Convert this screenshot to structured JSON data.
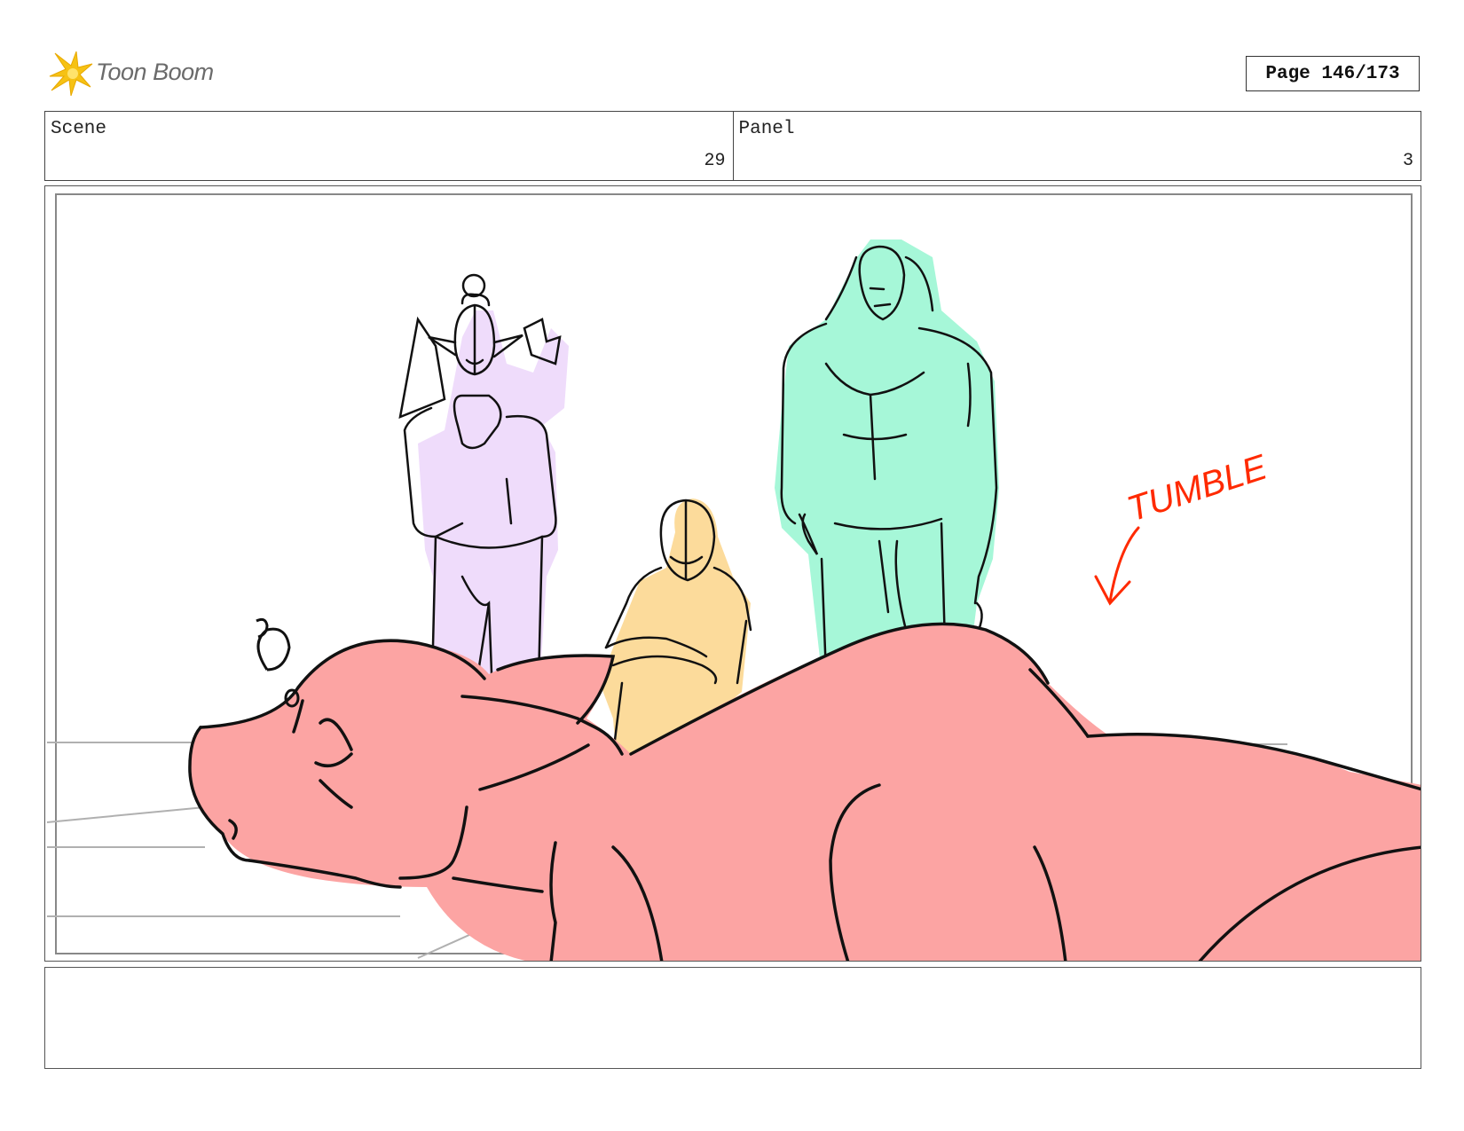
{
  "header": {
    "logo_text": "Toon Boom",
    "page_label": "Page 146/173"
  },
  "info": {
    "scene_label": "Scene",
    "scene_value": "29",
    "panel_label": "Panel",
    "panel_value": "3"
  },
  "drawing": {
    "annotation": "TUMBLE",
    "colors": {
      "purple_character": "#efdcfb",
      "yellow_character": "#fcdb9b",
      "green_character": "#a6f7d8",
      "pink_creature": "#fca4a3",
      "annotation": "#ff2a00"
    }
  },
  "notes": {
    "text": ""
  }
}
